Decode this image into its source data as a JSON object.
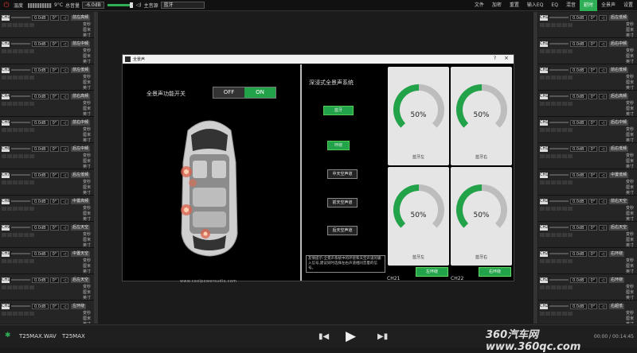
{
  "topbar": {
    "volume_label": "9°C",
    "temp_label": "温度",
    "master_volume_label": "总音量",
    "master_volume_value": "-6.0dB",
    "source_label": "主音源",
    "source_value": "蓝牙",
    "menu": [
      "文件",
      "加密",
      "重置",
      "输入EQ",
      "EQ",
      "混音",
      "延时",
      "全景声",
      "设置"
    ],
    "active_menu_index": 6
  },
  "left_channels": [
    {
      "id": "CH1",
      "db": "0.0dB",
      "deg": "0°",
      "name": "前左高频",
      "opt1": "变秒",
      "opt2": "厘米",
      "opt3": "英寸"
    },
    {
      "id": "CH2",
      "db": "0.0dB",
      "deg": "0°",
      "name": "前左中频",
      "opt1": "变秒",
      "opt2": "厘米",
      "opt3": "英寸"
    },
    {
      "id": "CH3",
      "db": "0.0dB",
      "deg": "0°",
      "name": "前左低频",
      "opt1": "变秒",
      "opt2": "厘米",
      "opt3": "英寸"
    },
    {
      "id": "CH4",
      "db": "0.0dB",
      "deg": "0°",
      "name": "前右高频",
      "opt1": "变秒",
      "opt2": "厘米",
      "opt3": "英寸"
    },
    {
      "id": "CH5",
      "db": "0.0dB",
      "deg": "0°",
      "name": "前右中频",
      "opt1": "变秒",
      "opt2": "厘米",
      "opt3": "英寸"
    },
    {
      "id": "CH6",
      "db": "0.0dB",
      "deg": "0°",
      "name": "后左中频",
      "opt1": "变秒",
      "opt2": "厘米",
      "opt3": "英寸"
    },
    {
      "id": "CH7",
      "db": "0.0dB",
      "deg": "0°",
      "name": "后左低频",
      "opt1": "变秒",
      "opt2": "厘米",
      "opt3": "英寸"
    },
    {
      "id": "CH8",
      "db": "0.0dB",
      "deg": "0°",
      "name": "中置高频",
      "opt1": "变秒",
      "opt2": "厘米",
      "opt3": "英寸"
    },
    {
      "id": "CH9",
      "db": "0.0dB",
      "deg": "0°",
      "name": "后左天空",
      "opt1": "变秒",
      "opt2": "厘米",
      "opt3": "英寸"
    },
    {
      "id": "CH10",
      "db": "0.0dB",
      "deg": "0°",
      "name": "中置天空",
      "opt1": "变秒",
      "opt2": "厘米",
      "opt3": "英寸"
    },
    {
      "id": "CH11",
      "db": "0.0dB",
      "deg": "0°",
      "name": "后左天空",
      "opt1": "变秒",
      "opt2": "厘米",
      "opt3": "英寸"
    },
    {
      "id": "CH12",
      "db": "0.0dB",
      "deg": "0°",
      "name": "左环绕",
      "opt1": "变秒",
      "opt2": "厘米",
      "opt3": "英寸"
    }
  ],
  "right_channels": [
    {
      "id": "CH13",
      "db": "0.0dB",
      "deg": "0°",
      "name": "后左低频",
      "opt1": "变秒",
      "opt2": "厘米",
      "opt3": "英寸"
    },
    {
      "id": "CH14",
      "db": "0.0dB",
      "deg": "0°",
      "name": "后右中频",
      "opt1": "变秒",
      "opt2": "厘米",
      "opt3": "英寸"
    },
    {
      "id": "CH15",
      "db": "0.0dB",
      "deg": "0°",
      "name": "前右低频",
      "opt1": "变秒",
      "opt2": "厘米",
      "opt3": "英寸"
    },
    {
      "id": "CH16",
      "db": "0.0dB",
      "deg": "0°",
      "name": "后右高频",
      "opt1": "变秒",
      "opt2": "厘米",
      "opt3": "英寸"
    },
    {
      "id": "CH17",
      "db": "0.0dB",
      "deg": "0°",
      "name": "后右中频",
      "opt1": "变秒",
      "opt2": "厘米",
      "opt3": "英寸"
    },
    {
      "id": "CH18",
      "db": "0.0dB",
      "deg": "0°",
      "name": "后右低频",
      "opt1": "变秒",
      "opt2": "厘米",
      "opt3": "英寸"
    },
    {
      "id": "CH19",
      "db": "0.0dB",
      "deg": "0°",
      "name": "中置低频",
      "opt1": "变秒",
      "opt2": "厘米",
      "opt3": "英寸"
    },
    {
      "id": "CH20",
      "db": "0.0dB",
      "deg": "0°",
      "name": "前右天空",
      "opt1": "变秒",
      "opt2": "厘米",
      "opt3": "英寸"
    },
    {
      "id": "CH21",
      "db": "0.0dB",
      "deg": "0°",
      "name": "后右天空",
      "opt1": "变秒",
      "opt2": "厘米",
      "opt3": "英寸"
    },
    {
      "id": "CH22",
      "db": "0.0dB",
      "deg": "0°",
      "name": "右环绕",
      "opt1": "变秒",
      "opt2": "厘米",
      "opt3": "英寸"
    },
    {
      "id": "CH23",
      "db": "0.0dB",
      "deg": "0°",
      "name": "右环绕",
      "opt1": "变秒",
      "opt2": "厘米",
      "opt3": "英寸"
    },
    {
      "id": "CH24",
      "db": "0.0dB",
      "deg": "0°",
      "name": "右超低",
      "opt1": "变秒",
      "opt2": "厘米",
      "opt3": "英寸"
    }
  ],
  "dialog": {
    "title": "全景声",
    "help": "?",
    "close": "×",
    "surround_label": "全景声功能开关",
    "toggle_off": "OFF",
    "toggle_on": "ON",
    "toggle_value": "ON",
    "website": "www.coolpowersudio.com",
    "immersive_label": "深浸式全景声系统",
    "mode_buttons": [
      "蓝牙",
      "环绕",
      "中天空声道",
      "前天空声道",
      "后天空声道"
    ],
    "note": "友情提示:全景声系统中的环绕和天空声道的输入信号,建议同时选择左右声道相同音量的信号。",
    "gauges": [
      {
        "name": "蓝牙左",
        "percent": 50,
        "label": "50%"
      },
      {
        "name": "蓝牙右",
        "percent": 50,
        "label": "50%"
      },
      {
        "name": "蓝牙左",
        "percent": 50,
        "label": "50%"
      },
      {
        "name": "蓝牙右",
        "percent": 50,
        "label": "50%"
      }
    ],
    "ch21_label": "CH21",
    "ch22_label": "CH22",
    "ch21_button": "左环绕",
    "ch22_button": "右环绕"
  },
  "bottombar": {
    "file1": "T25MAX.WAV",
    "file2": "T25MAX",
    "time": "00:00 / 00:14:45",
    "watermark": "360汽车网 www.360qc.com"
  },
  "colors": {
    "accent": "#22a34a",
    "bg": "#1b1b1b"
  }
}
